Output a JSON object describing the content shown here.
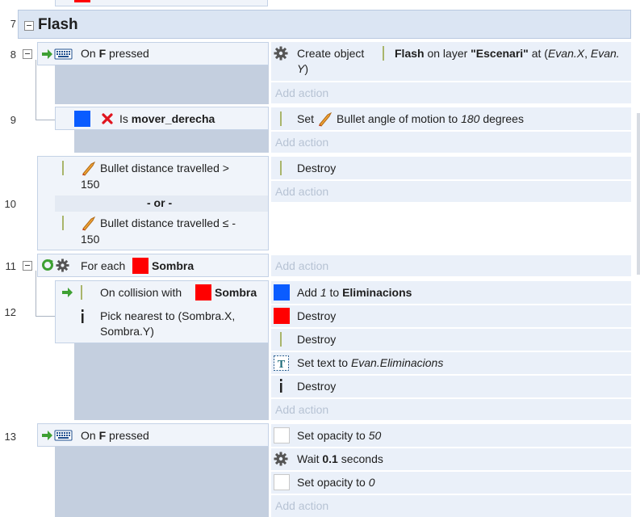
{
  "colors": {
    "red_square": "#ff0000",
    "blue_square": "#0a5cff",
    "group_bg": "#dbe5f3",
    "add_action": "#b7c3d4"
  },
  "top_fragment": {
    "line": "7"
  },
  "group": {
    "line": "7",
    "title": "Flash",
    "toggle_icon": "minus-box-icon"
  },
  "events": [
    {
      "line": "8",
      "cond": {
        "pre": "On ",
        "key": "F",
        "post": " pressed"
      },
      "action": {
        "text": "Create object",
        "object": "Flash",
        "on_layer": "on layer",
        "layer": "\"Escenari\"",
        "at": "at (",
        "x": "Evan.X",
        "sep": ", ",
        "y1": "Evan.",
        "y2": "Y",
        "close": ")"
      },
      "add_action": "Add action"
    },
    {
      "line": "9",
      "cond": {
        "pre": "Is ",
        "var": "mover_derecha"
      },
      "action": {
        "pre": "Set ",
        "text": "Bullet angle of motion to ",
        "value": "180",
        "post": " degrees"
      },
      "add_action": "Add action"
    },
    {
      "line": "10",
      "cond1": {
        "line1": "Bullet distance travelled >",
        "line2": "150"
      },
      "or": "- or -",
      "cond2": {
        "line1": "Bullet distance travelled ≤ -",
        "line2": "150"
      },
      "action": {
        "text": "Destroy"
      },
      "add_action": "Add action"
    },
    {
      "line": "11",
      "cond": {
        "pre": "For each ",
        "obj": "Sombra"
      },
      "add_action": "Add action"
    },
    {
      "line": "12",
      "cond1": {
        "pre": "On collision with ",
        "obj": "Sombra"
      },
      "cond2": {
        "line1": "Pick nearest to (Sombra.X,",
        "line2": "Sombra.Y)"
      },
      "actions": [
        {
          "pre": "Add ",
          "value": "1",
          "mid": " to ",
          "var": "Eliminacions"
        },
        {
          "text": "Destroy"
        },
        {
          "text": "Destroy"
        },
        {
          "pre": "Set text to ",
          "value": "Evan.Eliminacions"
        },
        {
          "text": "Destroy"
        }
      ],
      "add_action": "Add action"
    },
    {
      "line": "13",
      "cond": {
        "pre": "On ",
        "key": "F",
        "post": " pressed"
      },
      "actions": [
        {
          "pre": "Set opacity to ",
          "value": "50"
        },
        {
          "pre": "Wait ",
          "value": "0.1",
          "post": " seconds"
        },
        {
          "pre": "Set opacity to ",
          "value": "0"
        }
      ],
      "add_action": "Add action"
    }
  ]
}
